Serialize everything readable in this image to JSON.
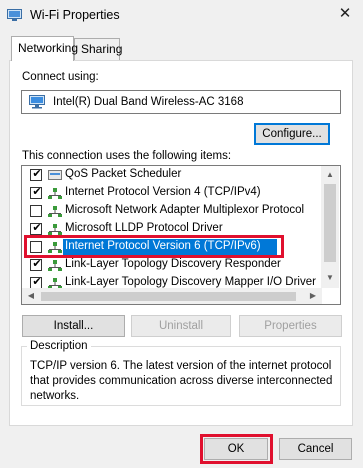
{
  "window": {
    "title": "Wi-Fi Properties",
    "close_symbol": "✕"
  },
  "tabs": [
    {
      "label": "Networking",
      "active": true
    },
    {
      "label": "Sharing",
      "active": false
    }
  ],
  "connect_using": {
    "label": "Connect using:",
    "adapter": "Intel(R) Dual Band Wireless-AC 3168",
    "adapter_icon": "network-adapter-icon",
    "configure_label": "Configure..."
  },
  "items": {
    "label": "This connection uses the following items:",
    "rows": [
      {
        "text": "QoS Packet Scheduler",
        "checked": true,
        "icon": "scheduler-icon",
        "selected": false
      },
      {
        "text": "Internet Protocol Version 4 (TCP/IPv4)",
        "checked": true,
        "icon": "protocol-icon",
        "selected": false
      },
      {
        "text": "Microsoft Network Adapter Multiplexor Protocol",
        "checked": false,
        "icon": "protocol-icon",
        "selected": false
      },
      {
        "text": "Microsoft LLDP Protocol Driver",
        "checked": true,
        "icon": "protocol-icon",
        "selected": false
      },
      {
        "text": "Internet Protocol Version 6 (TCP/IPv6)",
        "checked": false,
        "icon": "protocol-icon",
        "selected": true
      },
      {
        "text": "Link-Layer Topology Discovery Responder",
        "checked": true,
        "icon": "protocol-icon",
        "selected": false
      },
      {
        "text": "Link-Layer Topology Discovery Mapper I/O Driver",
        "checked": true,
        "icon": "protocol-icon",
        "selected": false
      }
    ]
  },
  "buttons": {
    "install": "Install...",
    "uninstall": "Uninstall",
    "properties": "Properties",
    "ok": "OK",
    "cancel": "Cancel"
  },
  "description": {
    "title": "Description",
    "text": "TCP/IP version 6. The latest version of the internet protocol that provides communication across diverse interconnected networks."
  },
  "colors": {
    "selection": "#0078d7",
    "highlight": "#e0102e",
    "window_bg": "#f0f0f0"
  }
}
